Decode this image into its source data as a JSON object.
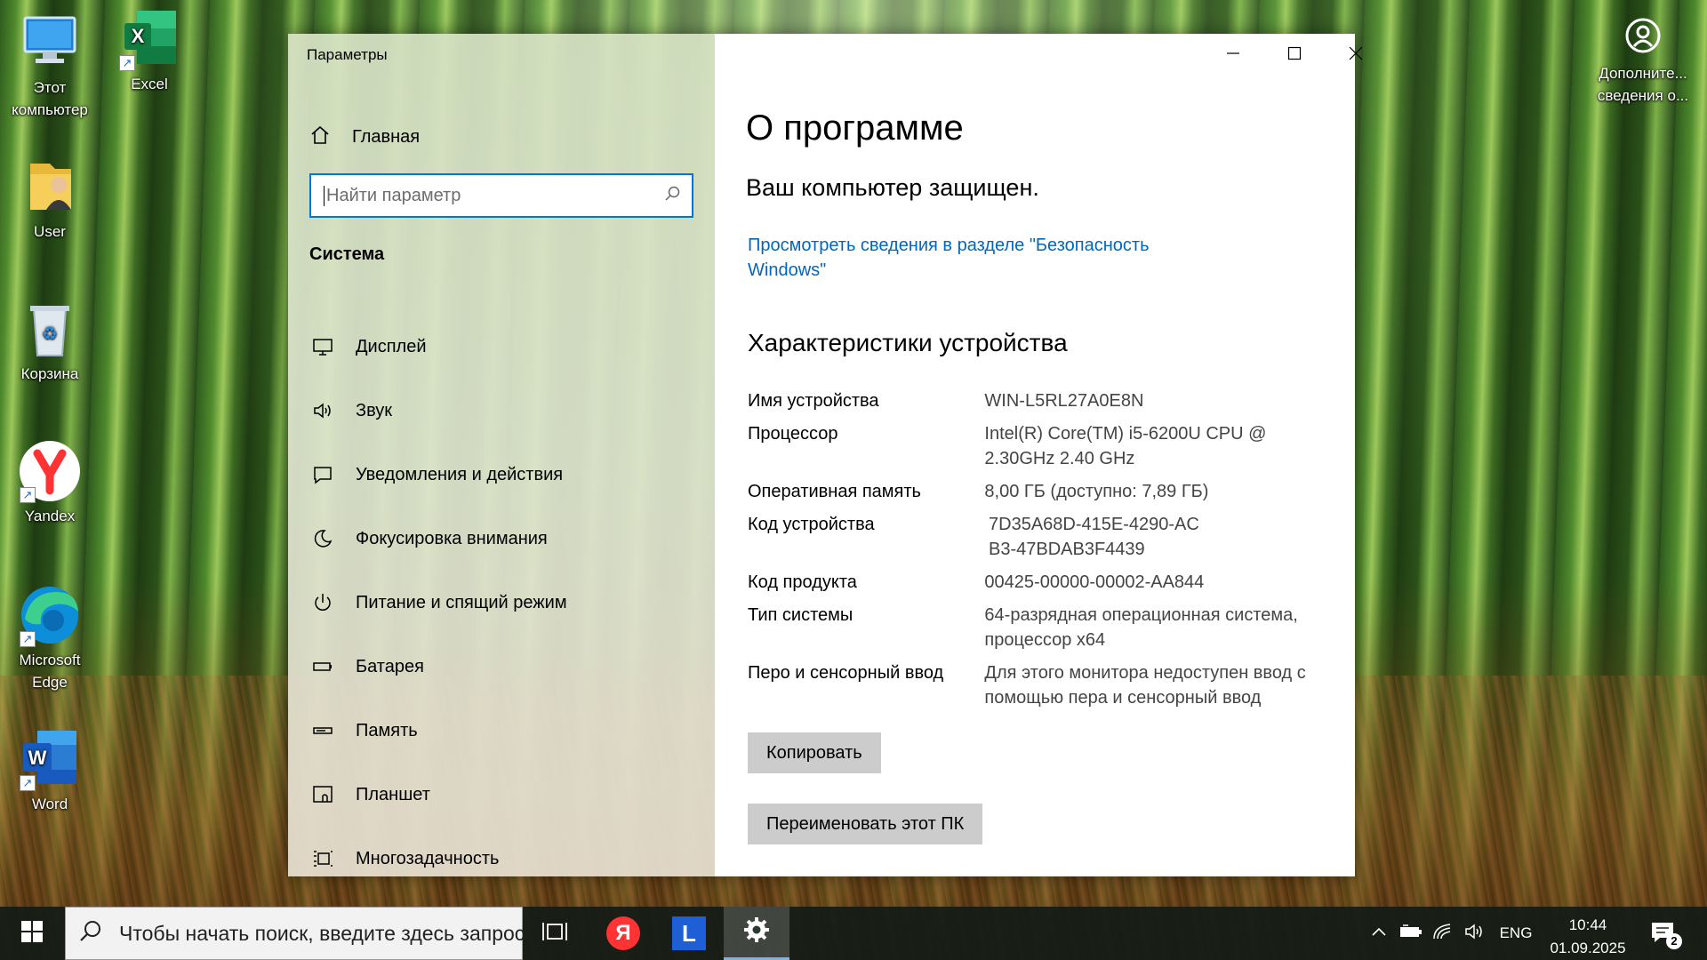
{
  "desktop": {
    "icons": [
      {
        "label_line1": "Этот",
        "label_line2": "компьютер"
      },
      {
        "label_line1": "Excel",
        "label_line2": ""
      },
      {
        "label_line1": "User",
        "label_line2": ""
      },
      {
        "label_line1": "Корзина",
        "label_line2": ""
      },
      {
        "label_line1": "Yandex",
        "label_line2": ""
      },
      {
        "label_line1": "Microsoft",
        "label_line2": "Edge"
      },
      {
        "label_line1": "Word",
        "label_line2": ""
      },
      {
        "label_line1": "Дополните...",
        "label_line2": "сведения о..."
      }
    ]
  },
  "window": {
    "title": "Параметры",
    "home_label": "Главная",
    "search_placeholder": "Найти параметр",
    "section_title": "Система",
    "nav_items": [
      {
        "label": "Дисплей",
        "icon": "monitor-icon"
      },
      {
        "label": "Звук",
        "icon": "speaker-icon"
      },
      {
        "label": "Уведомления и действия",
        "icon": "notification-icon"
      },
      {
        "label": "Фокусировка внимания",
        "icon": "moon-icon"
      },
      {
        "label": "Питание и спящий режим",
        "icon": "power-icon"
      },
      {
        "label": "Батарея",
        "icon": "battery-icon"
      },
      {
        "label": "Память",
        "icon": "storage-icon"
      },
      {
        "label": "Планшет",
        "icon": "tablet-icon"
      },
      {
        "label": "Многозадачность",
        "icon": "multitasking-icon"
      }
    ]
  },
  "about": {
    "title": "О программе",
    "protected_text": "Ваш компьютер защищен.",
    "security_link_line1": "Просмотреть сведения в разделе \"Безопасность",
    "security_link_line2": "Windows\"",
    "specs_title": "Характеристики устройства",
    "specs": [
      {
        "key": "Имя устройства",
        "value": "WIN-L5RL27A0E8N"
      },
      {
        "key": "Процессор",
        "value": "Intel(R) Core(TM) i5-6200U CPU @ 2.30GHz   2.40 GHz"
      },
      {
        "key": "Оперативная память",
        "value": "8,00 ГБ (доступно: 7,89 ГБ)"
      },
      {
        "key": "Код устройства",
        "value": "7D35A68D-415E-4290-ACB3-47BDAB3F4439"
      },
      {
        "key": "Код продукта",
        "value": "00425-00000-00002-AA844"
      },
      {
        "key": "Тип системы",
        "value": "64-разрядная операционная система, процессор x64"
      },
      {
        "key": "Перо и сенсорный ввод",
        "value": "Для этого монитора недоступен ввод с помощью пера и сенсорный ввод"
      }
    ],
    "copy_button": "Копировать",
    "rename_button": "Переименовать этот ПК"
  },
  "taskbar": {
    "search_text": "Чтобы начать поиск, введите здесь запрос",
    "language": "ENG",
    "time": "10:44",
    "date": "01.09.2025",
    "notification_count": "2",
    "yandex_letter": "Я",
    "launcher_letter": "L"
  },
  "colors": {
    "accent": "#0078d7",
    "link": "#0067c0"
  }
}
